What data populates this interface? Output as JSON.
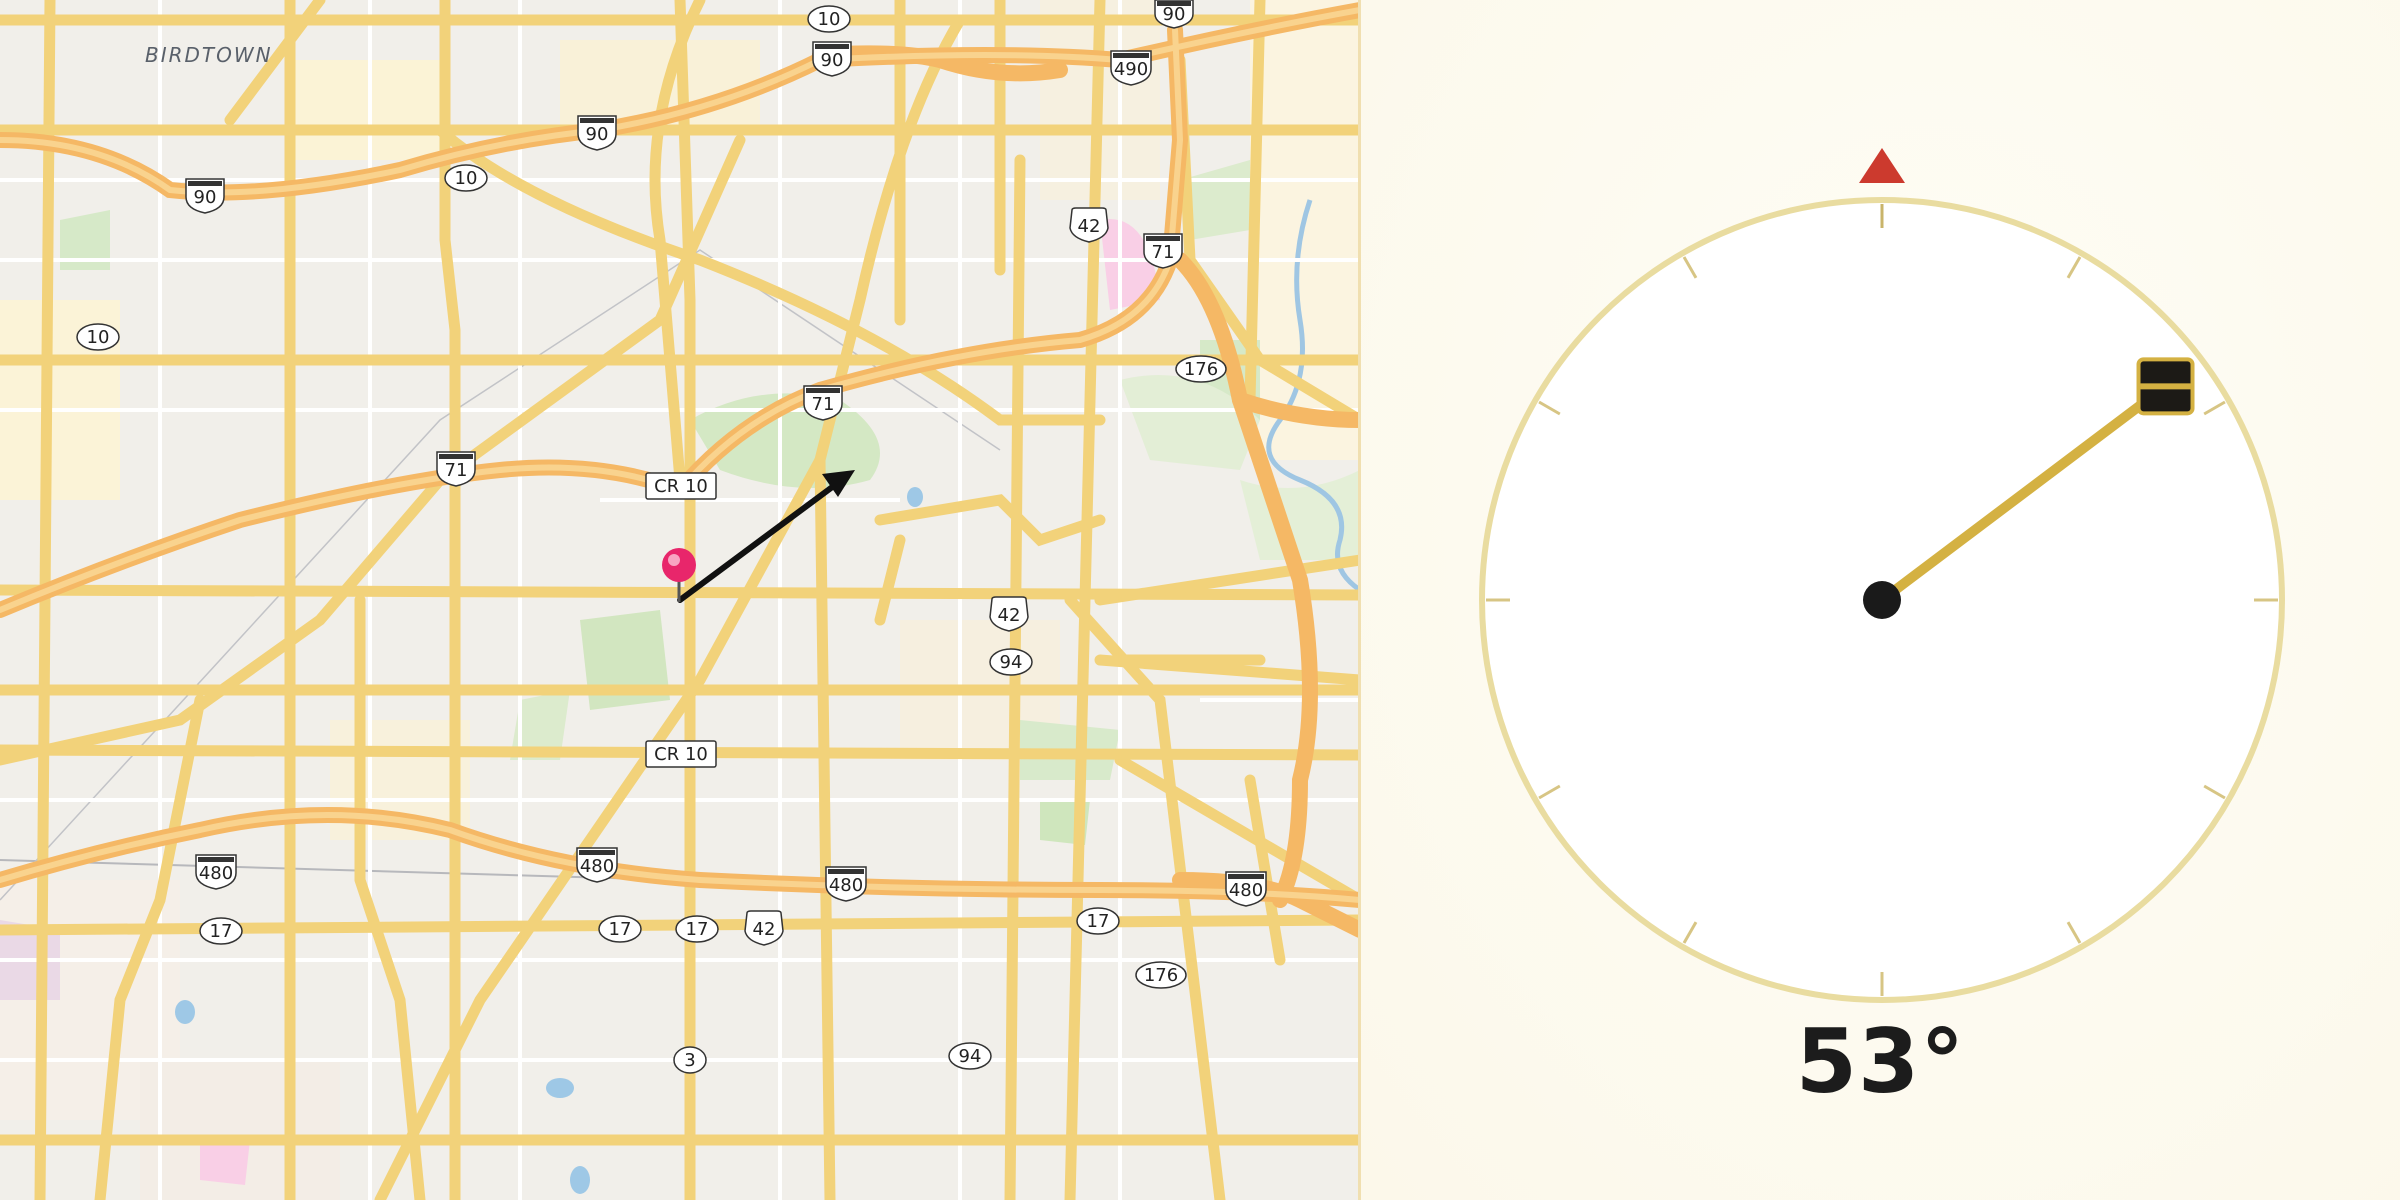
{
  "map": {
    "town_label": "BIRDTOWN",
    "marker": {
      "name": "location-pin",
      "color": "#e8266b"
    },
    "direction_arrow_color": "#111111",
    "road_colors": {
      "major": "#f5b968",
      "minor": "#fbd97d",
      "local": "#ffffff"
    },
    "route_labels": {
      "r1": "10",
      "r2": "90",
      "r3": "90",
      "r4": "490",
      "r5": "90",
      "r6": "90",
      "r7": "10",
      "r8": "10",
      "r9": "42",
      "r10": "71",
      "r11": "176",
      "r12": "71",
      "r13": "71",
      "r14": "CR 10",
      "r15": "42",
      "r16": "94",
      "r17": "CR 10",
      "r18": "480",
      "r19": "480",
      "r20": "480",
      "r21": "480",
      "r22": "17",
      "r23": "17",
      "r24": "17",
      "r25": "42",
      "r26": "17",
      "r27": "176",
      "r28": "3",
      "r29": "94"
    }
  },
  "compass": {
    "heading_degrees": 53,
    "heading_text": "53°",
    "north_marker_color": "#cc3a2e",
    "needle_color": "#d4b142",
    "ring_color": "#e9dca0"
  }
}
